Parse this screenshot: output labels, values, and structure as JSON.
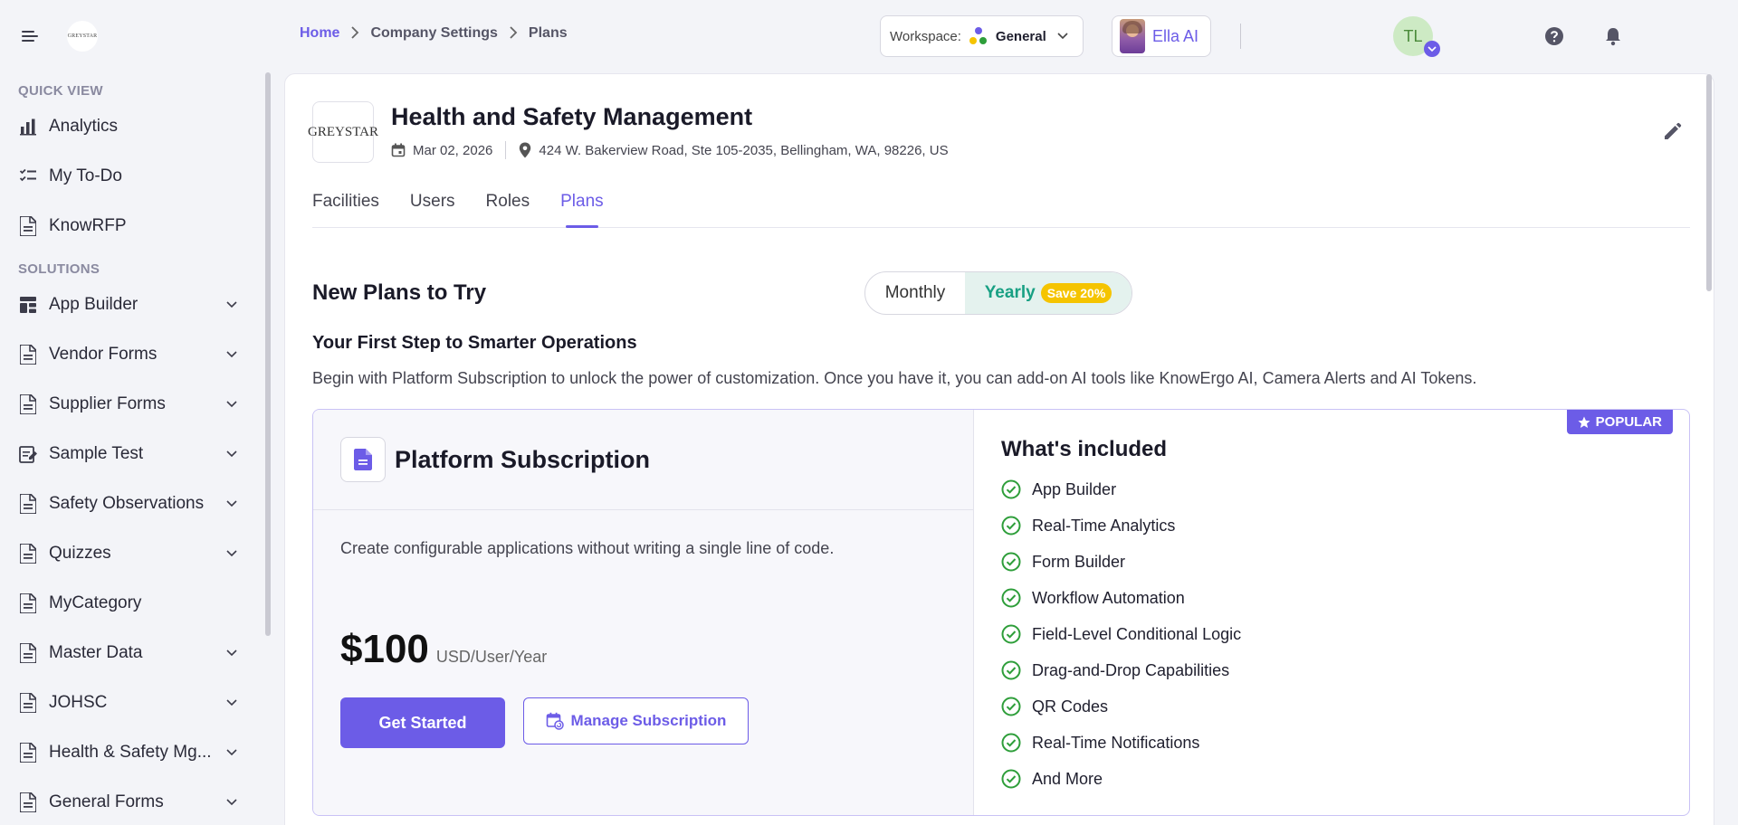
{
  "sidebar": {
    "logo_text": "GREYSTAR",
    "sections": [
      {
        "title": "QUICK VIEW"
      },
      {
        "title": "SOLUTIONS"
      }
    ],
    "quick_view": [
      {
        "label": "Analytics",
        "icon": "bar-chart-icon"
      },
      {
        "label": "My To-Do",
        "icon": "checklist-icon"
      },
      {
        "label": "KnowRFP",
        "icon": "document-icon"
      }
    ],
    "solutions": [
      {
        "label": "App Builder",
        "icon": "app-builder-icon",
        "expandable": true
      },
      {
        "label": "Vendor Forms",
        "icon": "document-icon",
        "expandable": true
      },
      {
        "label": "Supplier Forms",
        "icon": "document-icon",
        "expandable": true
      },
      {
        "label": "Sample Test",
        "icon": "edit-document-icon",
        "expandable": true
      },
      {
        "label": "Safety Observations",
        "icon": "document-icon",
        "expandable": true
      },
      {
        "label": "Quizzes",
        "icon": "document-icon",
        "expandable": true
      },
      {
        "label": "MyCategory",
        "icon": "document-icon",
        "expandable": false
      },
      {
        "label": "Master Data",
        "icon": "document-icon",
        "expandable": true
      },
      {
        "label": "JOHSC",
        "icon": "document-icon",
        "expandable": true
      },
      {
        "label": "Health & Safety Mg...",
        "icon": "document-icon",
        "expandable": true
      },
      {
        "label": "General Forms",
        "icon": "document-icon",
        "expandable": true
      }
    ]
  },
  "header": {
    "breadcrumb": {
      "home": "Home",
      "items": [
        "Company Settings",
        "Plans"
      ]
    },
    "workspace": {
      "label": "Workspace:",
      "value": "General"
    },
    "assistant": {
      "name": "Ella AI"
    },
    "user_initials": "TL"
  },
  "company": {
    "logo_text": "GREYSTAR",
    "name": "Health and Safety Management",
    "date": "Mar 02, 2026",
    "address": "424 W. Bakerview Road, Ste 105-2035, Bellingham, WA, 98226, US"
  },
  "tabs": [
    {
      "label": "Facilities",
      "active": false
    },
    {
      "label": "Users",
      "active": false
    },
    {
      "label": "Roles",
      "active": false
    },
    {
      "label": "Plans",
      "active": true
    }
  ],
  "plans_section": {
    "title": "New Plans to Try",
    "billing": {
      "monthly": "Monthly",
      "yearly": "Yearly",
      "save_badge": "Save 20%",
      "selected": "Yearly"
    },
    "subtitle": "Your First Step to Smarter Operations",
    "description": "Begin with Platform Subscription to unlock the power of customization. Once you have it, you can add-on AI tools like KnowErgo AI, Camera Alerts and AI Tokens."
  },
  "plan": {
    "name": "Platform Subscription",
    "description": "Create configurable applications without writing a single line of code.",
    "price": "$100",
    "price_unit": "USD/User/Year",
    "primary_button": "Get Started",
    "secondary_button": "Manage Subscription",
    "badge": "POPULAR",
    "included_title": "What's included",
    "features": [
      "App Builder",
      "Real-Time Analytics",
      "Form Builder",
      "Workflow Automation",
      "Field-Level Conditional Logic",
      "Drag-and-Drop Capabilities",
      "QR Codes",
      "Real-Time Notifications",
      "And More"
    ]
  },
  "colors": {
    "accent": "#6c5ce7",
    "success": "#2e9e3a",
    "yearly_text": "#18a083",
    "save_badge": "#f5c400"
  }
}
